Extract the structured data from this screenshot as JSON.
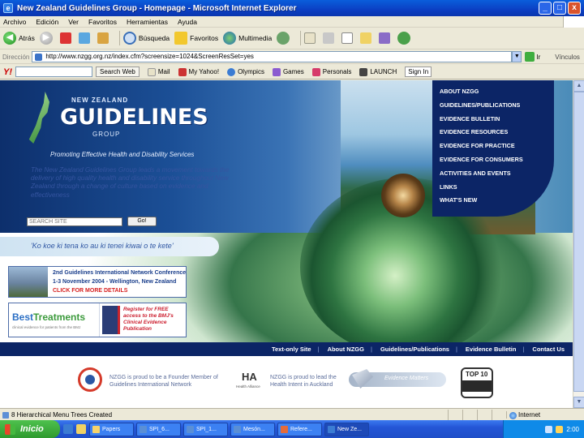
{
  "window": {
    "title": "New Zealand Guidelines Group - Homepage - Microsoft Internet Explorer",
    "buttons": [
      "_",
      "□",
      "x"
    ]
  },
  "menu": [
    "Archivo",
    "Edición",
    "Ver",
    "Favoritos",
    "Herramientas",
    "Ayuda"
  ],
  "toolbar": {
    "back": "Atrás",
    "search": "Búsqueda",
    "favorites": "Favoritos",
    "multimedia": "Multimedia"
  },
  "address": {
    "label": "Dirección",
    "url": "http://www.nzgg.org.nz/index.cfm?screensize=1024&ScreenResSet=yes",
    "go": "Ir",
    "links": "Vínculos"
  },
  "yahoo": {
    "logo": "Y!",
    "search_button": "Search Web",
    "mail": "Mail",
    "my_yahoo": "My Yahoo!",
    "olympics": "Olympics",
    "games": "Games",
    "personals": "Personals",
    "launch": "LAUNCH",
    "sign_in": "Sign In"
  },
  "page": {
    "logo": {
      "top": "NEW ZEALAND",
      "main": "GUIDELINES",
      "sub": "GROUP",
      "tagline": "Promoting Effective Health and Disability Services"
    },
    "nav": [
      "ABOUT NZGG",
      "GUIDELINES/PUBLICATIONS",
      "EVIDENCE BULLETIN",
      "EVIDENCE RESOURCES",
      "EVIDENCE FOR PRACTICE",
      "EVIDENCE FOR CONSUMERS",
      "ACTIVITIES AND EVENTS",
      "LINKS",
      "WHAT'S NEW"
    ],
    "intro": "The New Zealand Guidelines Group leads a movement towards the delivery of high quality health and disability service throughout New Zealand through a change of culture based on evidence and effectiveness",
    "search": {
      "placeholder": "SEARCH SITE",
      "button": "Go!"
    },
    "maori": "'Ko koe ki tena ko au ki tenei kiwai o te kete'",
    "conference": {
      "line1": "2nd Guidelines International Network Conference",
      "line2": "1-3 November 2004 - Wellington, New Zealand",
      "line3": "CLICK FOR MORE DETAILS"
    },
    "best_treatments": {
      "logo_a": "Best",
      "logo_b": "Treatments",
      "sub": "clinical evidence for patients from the BMJ",
      "text": "Register for FREE access to the BMJ's Clinical Evidence Publication"
    },
    "footer_nav": [
      "Text-only Site",
      "About NZGG",
      "Guidelines/Publications",
      "Evidence Bulletin",
      "Contact Us"
    ],
    "partners": {
      "text1": "NZGG is proud to be a Founder Member of Guidelines International Network",
      "logo2": "HA",
      "logo2_sub": "Health Alliance",
      "text2": "NZGG is proud to lead the Health Intent in Auckland",
      "bar": "Evidence Matters",
      "top10_title": "TOP 10"
    }
  },
  "status": {
    "message": "8 Hierarchical Menu Trees Created",
    "zone": "Internet"
  },
  "taskbar": {
    "start": "Inicio",
    "tasks": [
      "Papers",
      "SPI_6...",
      "SPI_1...",
      "Mesón...",
      "Refere...",
      "New Ze..."
    ],
    "tray_time": "2:00"
  }
}
